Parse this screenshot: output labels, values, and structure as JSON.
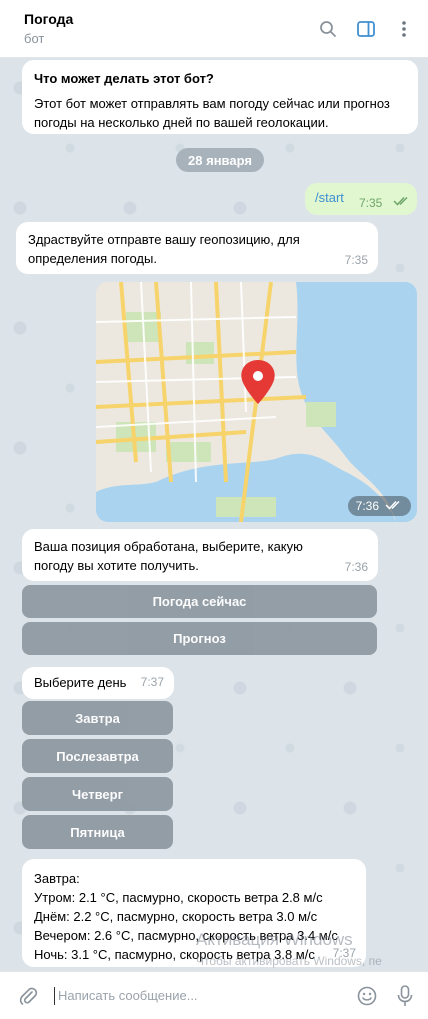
{
  "header": {
    "title": "Погода",
    "subtitle": "бот",
    "icons": [
      "search-icon",
      "sidebar-toggle-icon",
      "more-vertical-icon"
    ]
  },
  "messages": {
    "intro": {
      "title": "Что может делать этот бот?",
      "text": "Этот бот может отправлять вам погоду сейчас или прогноз погоды на несколько дней по вашей геолокации."
    },
    "date": "28 января",
    "start": {
      "text": "/start",
      "time": "7:35"
    },
    "greet": {
      "text": "Здраствуйте отправте вашу геопозицию, для определения погоды.",
      "time": "7:35"
    },
    "map": {
      "time": "7:36"
    },
    "processed": {
      "text": "Ваша позиция обработана, выберите, какую погоду вы хотите получить.",
      "time": "7:36"
    },
    "choose_day": {
      "text": "Выберите день",
      "time": "7:37"
    },
    "forecast": {
      "heading": "Завтра:",
      "morning": "Утром: 2.1 °C, пасмурно, скорость ветра 2.8 м/с",
      "day": "Днём: 2.2 °C, пасмурно, скорость ветра 3.0 м/с",
      "evening": "Вечером: 2.6 °C, пасмурно, скорость ветра 3.4 м/с",
      "night": "Ночь: 3.1 °C, пасмурно, скорость ветра 3.8 м/с",
      "time": "7:37"
    }
  },
  "keyboard1": {
    "weather_now": "Погода сейчас",
    "forecast": "Прогноз"
  },
  "keyboard2": {
    "tomorrow": "Завтра",
    "after_tomorrow": "Послезавтра",
    "thursday": "Четверг",
    "friday": "Пятница"
  },
  "watermark": {
    "line1": "Активация Windows",
    "line2": "Чтобы активировать Windows, пе"
  },
  "composer": {
    "placeholder": "Написать сообщение..."
  },
  "colors": {
    "accent": "#3f8fd2",
    "chat_bg": "#dde4e9",
    "outgoing_bubble": "#e1f7d0",
    "keyboard_button": "#8d98a1",
    "map_pin": "#e53935"
  }
}
